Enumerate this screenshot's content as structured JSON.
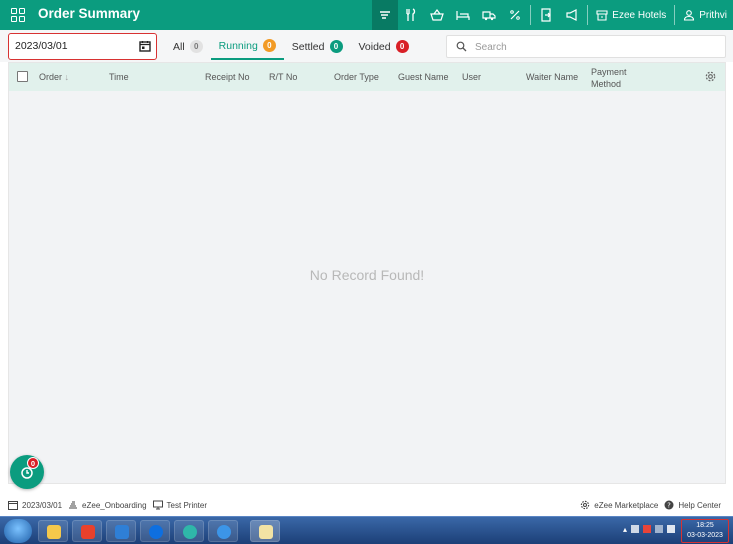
{
  "header": {
    "title": "Order Summary",
    "hotel_label": "Ezee Hotels",
    "user_label": "Prithvi",
    "accent": "#0b9c7f"
  },
  "toolbar": {
    "date_value": "2023/03/01",
    "tabs": [
      {
        "label": "All",
        "count": "0",
        "color": "grey"
      },
      {
        "label": "Running",
        "count": "0",
        "color": "orange"
      },
      {
        "label": "Settled",
        "count": "0",
        "color": "green"
      },
      {
        "label": "Voided",
        "count": "0",
        "color": "red"
      }
    ],
    "search_placeholder": "Search"
  },
  "table": {
    "columns": [
      "Order",
      "Time",
      "Receipt No",
      "R/T No",
      "Order Type",
      "Guest Name",
      "User",
      "Waiter Name",
      "Payment",
      "Method"
    ],
    "empty_text": "No Record Found!"
  },
  "fab": {
    "badge": "0"
  },
  "statusbar": {
    "date": "2023/03/01",
    "terminal": "eZee_Onboarding",
    "printer": "Test Printer",
    "marketplace": "eZee Marketplace",
    "help": "Help Center"
  },
  "taskbar": {
    "time": "18:25",
    "date": "03-03-2023"
  }
}
